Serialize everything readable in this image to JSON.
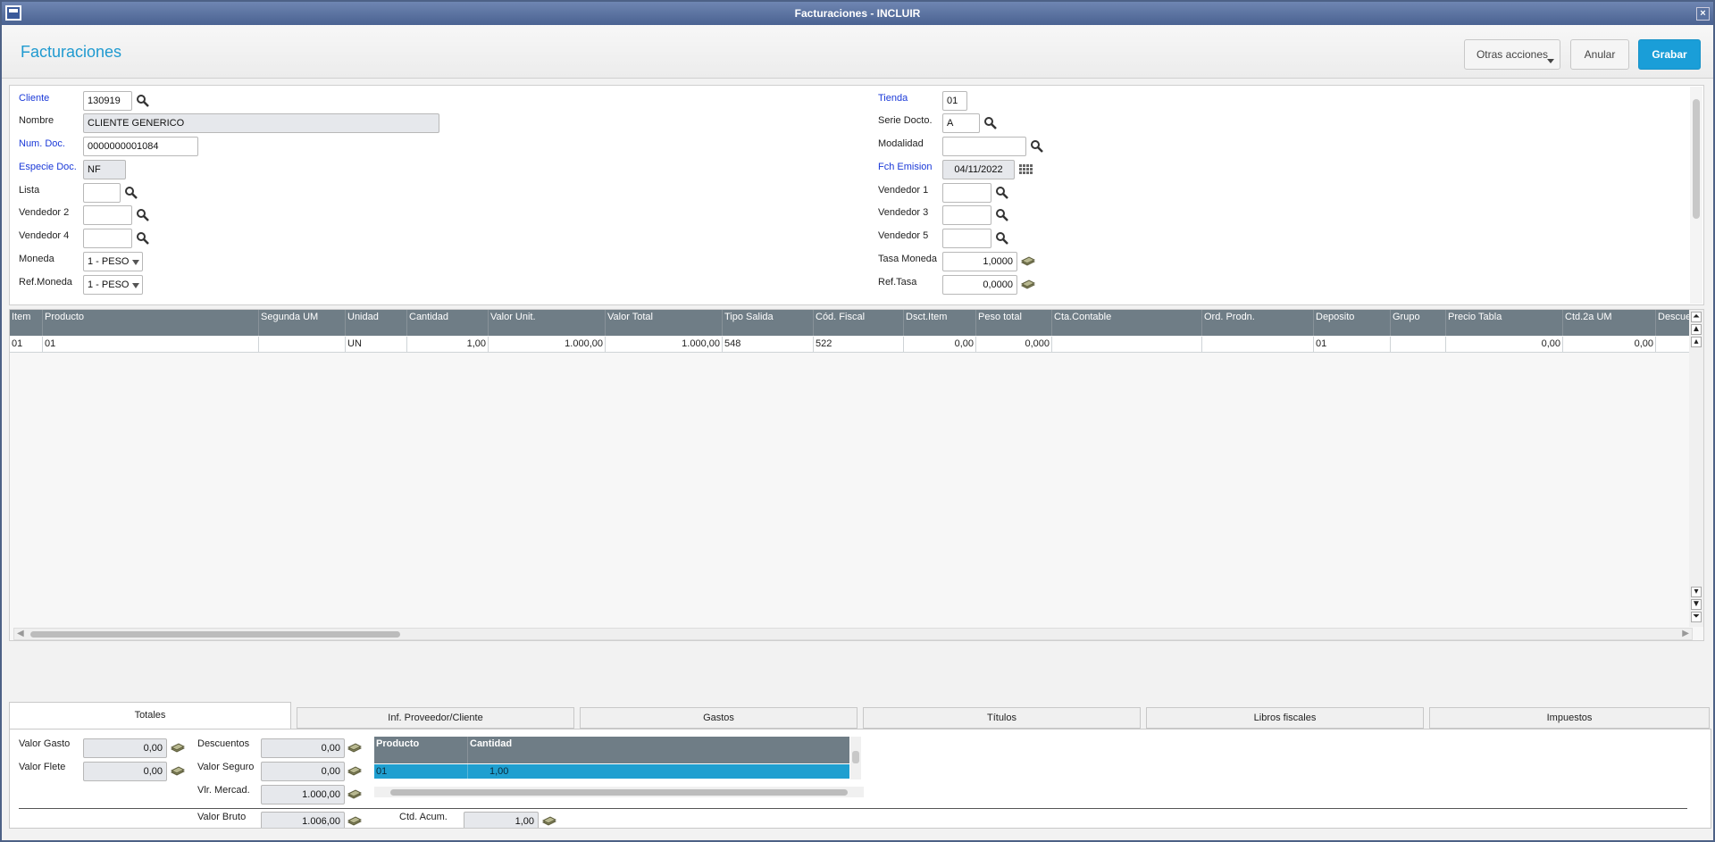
{
  "window": {
    "title": "Facturaciones - INCLUIR"
  },
  "header": {
    "title": "Facturaciones",
    "btn_more": "Otras acciones",
    "btn_cancel": "Anular",
    "btn_save": "Grabar"
  },
  "form": {
    "cliente": {
      "label": "Cliente",
      "value": "130919"
    },
    "nombre": {
      "label": "Nombre",
      "value": "CLIENTE GENERICO"
    },
    "num_doc": {
      "label": "Num. Doc.",
      "value": "0000000001084"
    },
    "especie_doc": {
      "label": "Especie Doc.",
      "value": "NF"
    },
    "lista": {
      "label": "Lista",
      "value": ""
    },
    "vendedor2": {
      "label": "Vendedor 2",
      "value": ""
    },
    "vendedor4": {
      "label": "Vendedor 4",
      "value": ""
    },
    "moneda": {
      "label": "Moneda",
      "value": "1 - PESO"
    },
    "ref_moneda": {
      "label": "Ref.Moneda",
      "value": "1 - PESO"
    },
    "tienda": {
      "label": "Tienda",
      "value": "01"
    },
    "serie_docto": {
      "label": "Serie Docto.",
      "value": "A"
    },
    "modalidad": {
      "label": "Modalidad",
      "value": ""
    },
    "fch_emision": {
      "label": "Fch Emision",
      "value": "04/11/2022"
    },
    "vendedor1": {
      "label": "Vendedor 1",
      "value": ""
    },
    "vendedor3": {
      "label": "Vendedor 3",
      "value": ""
    },
    "vendedor5": {
      "label": "Vendedor 5",
      "value": ""
    },
    "tasa_moneda": {
      "label": "Tasa Moneda",
      "value": "1,0000"
    },
    "ref_tasa": {
      "label": "Ref.Tasa",
      "value": "0,0000"
    }
  },
  "grid": {
    "columns": [
      "Item",
      "Producto",
      "Segunda UM",
      "Unidad",
      "Cantidad",
      "Valor Unit.",
      "Valor Total",
      "Tipo Salida",
      "Cód. Fiscal",
      "Dsct.Item",
      "Peso total",
      "Cta.Contable",
      "Ord. Prodn.",
      "Deposito",
      "Grupo",
      "Precio Tabla",
      "Ctd.2a UM",
      "Descuento"
    ],
    "row": [
      "01",
      "01",
      "",
      "UN",
      "1,00",
      "1.000,00",
      "1.000,00",
      "548",
      "522",
      "0,00",
      "0,000",
      "",
      "",
      "01",
      "",
      "0,00",
      "0,00",
      ""
    ]
  },
  "tabs": [
    "Totales",
    "Inf. Proveedor/Cliente",
    "Gastos",
    "Títulos",
    "Libros fiscales",
    "Impuestos"
  ],
  "totales": {
    "valor_gasto": {
      "label": "Valor Gasto",
      "value": "0,00"
    },
    "valor_flete": {
      "label": "Valor Flete",
      "value": "0,00"
    },
    "descuentos": {
      "label": "Descuentos",
      "value": "0,00"
    },
    "valor_seguro": {
      "label": "Valor Seguro",
      "value": "0,00"
    },
    "vlr_mercad": {
      "label": "Vlr. Mercad.",
      "value": "1.000,00"
    },
    "valor_bruto": {
      "label": "Valor Bruto",
      "value": "1.006,00"
    },
    "ctd_acum": {
      "label": "Ctd. Acum.",
      "value": "1,00"
    },
    "mini_columns": [
      "Producto",
      "Cantidad"
    ],
    "mini_row": [
      "01",
      "1,00"
    ]
  },
  "colors": {
    "accent": "#1a9ed8",
    "required_label": "#1a39d8",
    "grid_header": "#6f7d86",
    "selected_row": "#1f9fd0"
  },
  "icons": {
    "lookup": "search-icon",
    "calendar": "calendar-icon",
    "currency": "money-icon"
  }
}
